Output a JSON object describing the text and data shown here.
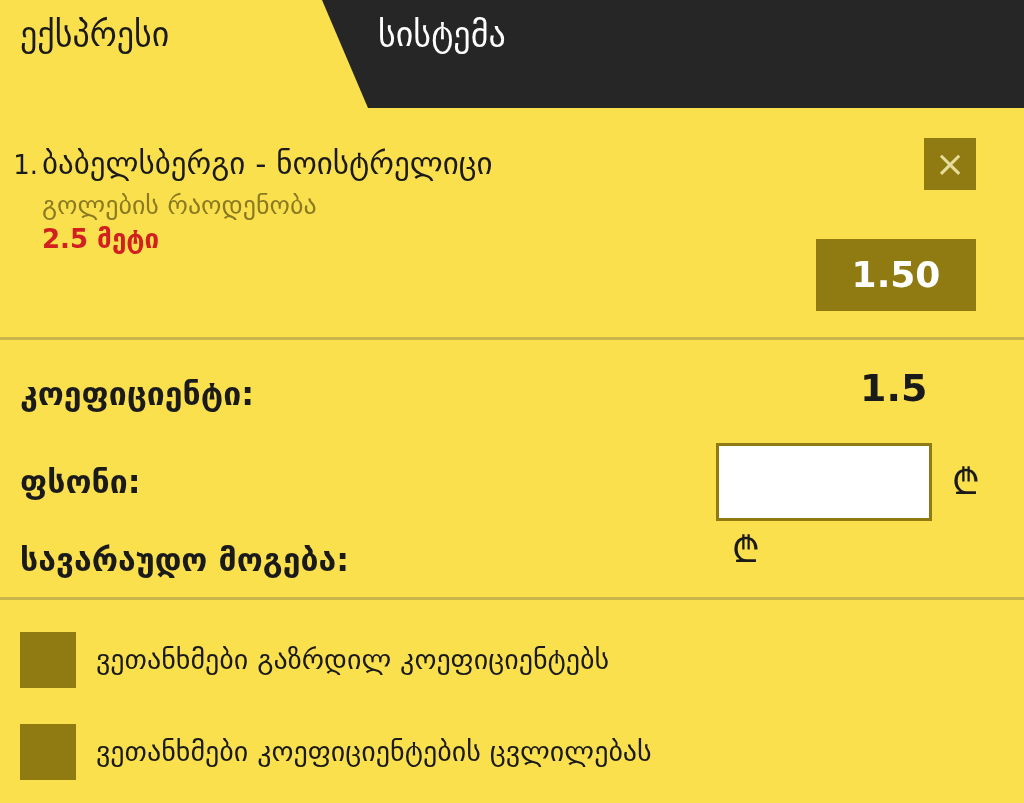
{
  "tabs": [
    {
      "label": "ექსპრესი",
      "selected": true
    },
    {
      "label": "სისტემა",
      "selected": false
    }
  ],
  "bets": [
    {
      "number": "1.",
      "title": "ბაბელსბერგი - ნოისტრელიცი",
      "market": "გოლების რაოდენობა",
      "selection": "2.5 მეტი",
      "close": "×",
      "odds": "1.50"
    }
  ],
  "summary": {
    "odds_label": "კოეფიციენტი:",
    "odds_value": "1.5",
    "stake_label": "ფსონი:",
    "stake_currency": "₾",
    "win_label": "სავარაუდო მოგება:",
    "win_currency": "₾"
  },
  "options": [
    {
      "label": "ვეთანხმები გაზრდილ კოეფიციენტებს",
      "checked": false
    },
    {
      "label": "ვეთანხმები კოეფიციენტების ცვლილებას",
      "checked": false
    }
  ]
}
